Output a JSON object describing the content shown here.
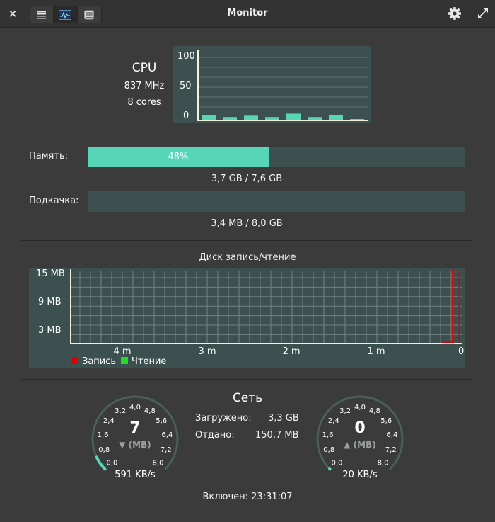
{
  "window": {
    "title": "Monitor",
    "close_glyph": "×",
    "view_tabs": [
      {
        "icon": "list-icon",
        "active": false
      },
      {
        "icon": "system-monitor-icon",
        "active": true
      },
      {
        "icon": "drive-icon",
        "active": false
      }
    ],
    "settings_icon": "gear-icon",
    "maximize_icon": "maximize-icon"
  },
  "cpu": {
    "title": "CPU",
    "frequency": "837  MHz",
    "cores": "8 cores",
    "chart": {
      "y_ticks": [
        "100",
        "50",
        "0"
      ],
      "ylim": [
        0,
        100
      ],
      "values": [
        7,
        4,
        6,
        4,
        9,
        4,
        7,
        1
      ]
    }
  },
  "memory": {
    "label": "Память:",
    "percent_text": "48%",
    "fraction": 0.48,
    "usage": "3,7 GB / 7,6 GB"
  },
  "swap": {
    "label": "Подкачка:",
    "fraction": 0,
    "usage": "3,4 MB / 8,0 GB"
  },
  "disk": {
    "title": "Диск запись/чтение",
    "chart_data": {
      "type": "line",
      "ylim": [
        0,
        15
      ],
      "y_ticks": [
        "15 MB",
        "9 MB",
        "3 MB"
      ],
      "x_ticks": [
        "4 m",
        "3 m",
        "2 m",
        "1 m",
        "0 m"
      ],
      "series": [
        {
          "name": "Запись",
          "color": "#e00000",
          "spikes_minutes_ago": [
            0.1,
            0.02
          ],
          "values_mb": [
            15,
            15
          ]
        },
        {
          "name": "Чтение",
          "color": "#22dd22",
          "spikes_minutes_ago": [],
          "values_mb": []
        }
      ]
    },
    "legend": [
      {
        "label": "Запись",
        "color": "#e00000"
      },
      {
        "label": "Чтение",
        "color": "#22dd22"
      }
    ]
  },
  "network": {
    "title": "Сеть",
    "downloaded_label": "Загружено:",
    "downloaded_value": "3,3 GB",
    "uploaded_label": "Отдано:",
    "uploaded_value": "150,7 MB",
    "gauge_ticks": [
      "0,0",
      "0,8",
      "1,6",
      "2,4",
      "3,2",
      "4,0",
      "4,8",
      "5,6",
      "6,4",
      "7,2",
      "8,0"
    ],
    "download_gauge": {
      "value": "7",
      "unit": "▼ (MB)",
      "rate": "591 KB/s",
      "level_mb": 0.59
    },
    "upload_gauge": {
      "value": "0",
      "unit": "▲ (MB)",
      "rate": "20 KB/s",
      "level_mb": 0.02
    }
  },
  "uptime": "Включен: 23:31:07",
  "colors": {
    "background": "#3b3b3b",
    "accent": "#56d6b7",
    "chart_bg": "#3d5050",
    "titlebar": "#333333"
  }
}
